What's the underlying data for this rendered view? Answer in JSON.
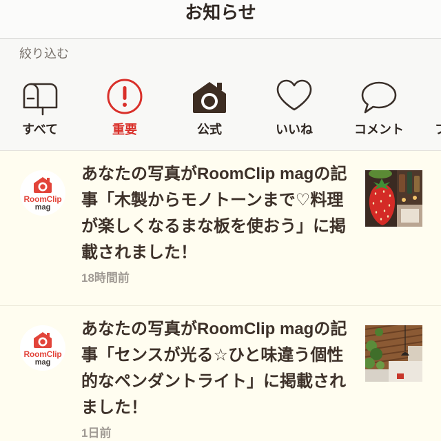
{
  "header": {
    "title": "お知らせ"
  },
  "filter": {
    "label": "絞り込む",
    "items": [
      {
        "label": "すべて",
        "icon": "mailbox-icon",
        "selected": false
      },
      {
        "label": "重要",
        "icon": "exclamation-circle-icon",
        "selected": false
      },
      {
        "label": "公式",
        "icon": "house-camera-icon",
        "selected": false
      },
      {
        "label": "いいね",
        "icon": "heart-icon",
        "selected": false
      },
      {
        "label": "コメント",
        "icon": "comment-bubble-icon",
        "selected": false
      }
    ],
    "partial_label": "フ"
  },
  "notifications": [
    {
      "avatar": {
        "brand": "RoomClip",
        "sub": "mag",
        "icon": "roomclip-logo-icon"
      },
      "message_lines": [
        "あなたの写真がRoomClip magの記",
        "事「木製からモノトーンまで♡料理",
        "が楽しくなるまな板を使おう」に掲",
        "載されました！"
      ],
      "time": "18時間前"
    },
    {
      "avatar": {
        "brand": "RoomClip",
        "sub": "mag",
        "icon": "roomclip-logo-icon"
      },
      "message_lines": [
        "あなたの写真がRoomClip magの記",
        "事「センスが光る☆ひと味違う個性",
        "的なペンダントライト」に掲載され",
        "ました！"
      ],
      "time": "1日前"
    }
  ],
  "colors": {
    "accent": "#d9302a",
    "brand": "#e2443a",
    "text": "#3d3129",
    "muted": "#a09a94",
    "icon": "#3a302a",
    "list_background": "#fffdf0"
  }
}
